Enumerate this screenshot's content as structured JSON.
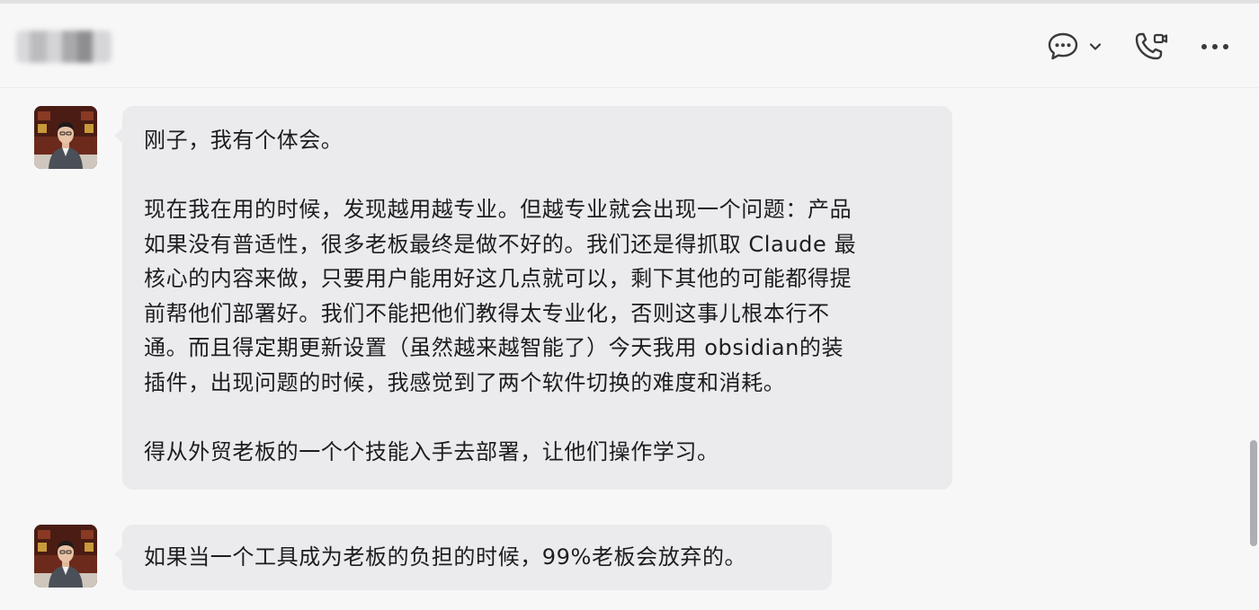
{
  "header": {
    "contact_name": "●●●●●",
    "icons": [
      "chat-bubble-icon",
      "chevron-down-icon",
      "video-call-icon",
      "more-icon"
    ]
  },
  "messages": [
    {
      "avatar": "avatar-man-in-suit",
      "paragraphs": [
        [
          "刚子，我有个体会。"
        ],
        [
          "现在我在用的时候，发现越用越专业。但越专业就会出现一个问题：产品",
          "如果没有普适性，很多老板最终是做不好的。我们还是得抓取 Claude 最",
          "核心的内容来做，只要用户能用好这几点就可以，剩下其他的可能都得提",
          "前帮他们部署好。我们不能把他们教得太专业化，否则这事儿根本行不",
          "通。而且得定期更新设置（虽然越来越智能了）今天我用 obsidian的装",
          "插件，出现问题的时候，我感觉到了两个软件切换的难度和消耗。"
        ],
        [
          "得从外贸老板的一个个技能入手去部署，让他们操作学习。"
        ]
      ]
    },
    {
      "avatar": "avatar-man-in-suit",
      "paragraphs": [
        [
          "如果当一个工具成为老板的负担的时候，99%老板会放弃的。"
        ]
      ]
    }
  ],
  "colors": {
    "background": "#f7f7f8",
    "bubble": "#ebebed",
    "text": "#1d1d1f",
    "icon": "#3a3a3c"
  }
}
